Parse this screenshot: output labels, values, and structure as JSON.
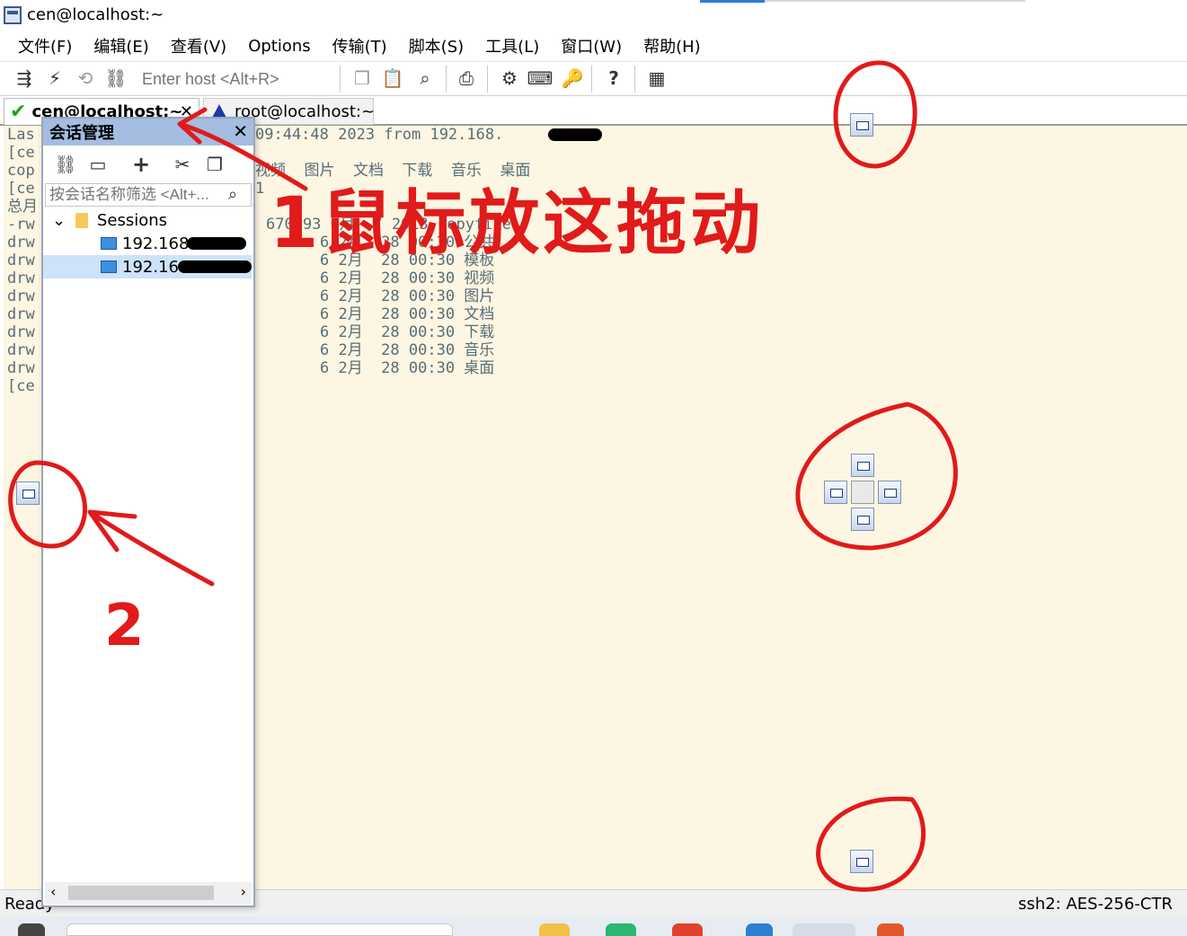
{
  "window": {
    "title": "cen@localhost:~"
  },
  "menu": {
    "items": [
      "文件(F)",
      "编辑(E)",
      "查看(V)",
      "Options",
      "传输(T)",
      "脚本(S)",
      "工具(L)",
      "窗口(W)",
      "帮助(H)"
    ]
  },
  "toolbar": {
    "host_placeholder": "Enter host <Alt+R>"
  },
  "tabs": [
    {
      "label": "cen@localhost:~",
      "status": "connected"
    },
    {
      "label": "root@localhost:~",
      "status": "warning"
    }
  ],
  "terminal": {
    "lines": [
      {
        "left": "Las",
        "right": "09:44:48 2023 from 192.168."
      },
      {
        "left": "[ce",
        "right": ""
      },
      {
        "left": "cop",
        "right": "视频  图片  文档  下载  音乐  桌面"
      },
      {
        "left": "[ce",
        "right": "1"
      },
      {
        "left": "总月",
        "right": ""
      },
      {
        "left": "-rw",
        "right": "670293 6月  7 2013 copyfile"
      },
      {
        "left": "drw",
        "right": "6 2月  28 00:30 公共"
      },
      {
        "left": "drw",
        "right": "6 2月  28 00:30 模板"
      },
      {
        "left": "drw",
        "right": "6 2月  28 00:30 视频"
      },
      {
        "left": "drw",
        "right": "6 2月  28 00:30 图片"
      },
      {
        "left": "drw",
        "right": "6 2月  28 00:30 文档"
      },
      {
        "left": "drw",
        "right": "6 2月  28 00:30 下载"
      },
      {
        "left": "drw",
        "right": "6 2月  28 00:30 音乐"
      },
      {
        "left": "drw",
        "right": "6 2月  28 00:30 桌面"
      },
      {
        "left": "[ce",
        "right": ""
      }
    ]
  },
  "session_manager": {
    "title": "会话管理",
    "filter_placeholder": "按会话名称筛选 <Alt+...",
    "tree": {
      "folder": "Sessions",
      "sessions": [
        "192.168.",
        "192.16"
      ]
    }
  },
  "status": {
    "left": "Ready",
    "right": "ssh2: AES-256-CTR"
  },
  "annotations": {
    "instruction": "1鼠标放这拖动",
    "marker_2": "2"
  },
  "colors": {
    "terminal_bg": "#fdf6e3",
    "terminal_fg": "#586e75",
    "panel_header": "#a4bde0",
    "annotation": "#e11a1a"
  }
}
